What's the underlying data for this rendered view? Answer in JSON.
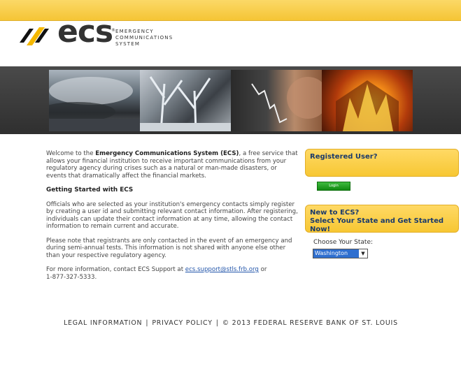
{
  "header": {
    "logo_text": "ecs",
    "logo_sub_1": "EMERGENCY",
    "logo_sub_2": "COMMUNICATIONS",
    "logo_sub_3": "SYSTEM",
    "registered_mark": "®"
  },
  "main": {
    "welcome_pre": "Welcome to the ",
    "welcome_bold": "Emergency Communications System (ECS)",
    "welcome_post": ", a free service that allows your financial institution to receive important communications from your regulatory agency during crises such as a natural or man-made disasters, or events that dramatically affect the financial markets.",
    "getting_started_heading": "Getting Started with ECS",
    "para_officials": "Officials who are selected as your institution's emergency contacts simply register by creating a user id and submitting relevant contact information. After registering, individuals can update their contact information at any time, allowing the contact information to remain current and accurate.",
    "para_note": "Please note that registrants are only contacted in the event of an emergency and during semi-annual tests. This information is not shared with anyone else other than your respective regulatory agency.",
    "info_pre": "For more information, contact ECS Support at ",
    "support_email": "ecs.support@stls.frb.org",
    "info_post": " or",
    "support_phone": "1-877-327-5333."
  },
  "sidebar": {
    "registered_title": "Registered User?",
    "login_label": "Login",
    "new_title_1": "New to ECS?",
    "new_title_2": "Select Your State and Get Started Now!",
    "choose_label": "Choose Your State:",
    "state_selected": "Washington"
  },
  "footer": {
    "legal": "LEGAL INFORMATION",
    "privacy": "PRIVACY POLICY",
    "copyright": "© 2013 FEDERAL RESERVE BANK OF ST. LOUIS",
    "sep": "|"
  },
  "colors": {
    "accent_yellow": "#f5c535",
    "heading_blue": "#1a3a6b",
    "login_green": "#1e9a1e",
    "link_blue": "#2255aa"
  },
  "icons": {
    "logo": "ecs-stripes-logo-icon",
    "dropdown": "chevron-down-icon"
  }
}
